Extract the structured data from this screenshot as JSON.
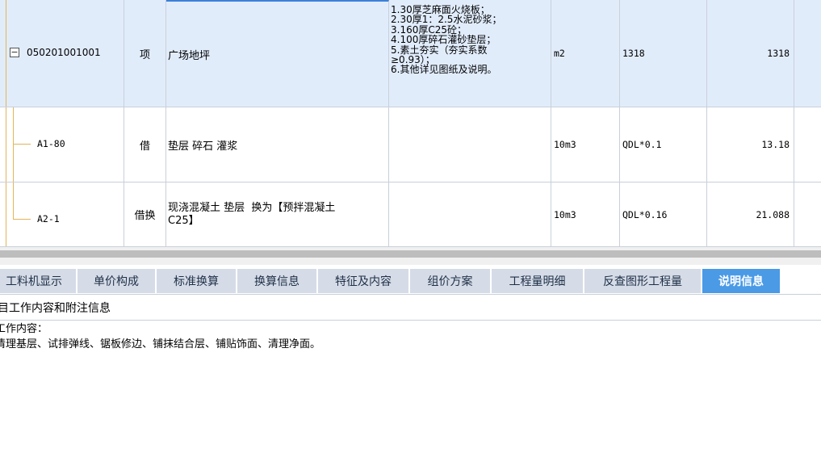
{
  "grid": {
    "rows": [
      {
        "code": "050201001001",
        "type": "项",
        "name": "广场地坪",
        "features": "1.30厚芝麻面火烧板；\n2.30厚1：2.5水泥砂浆；\n3.160厚C25砼；\n4.100厚碎石灌砂垫层；\n5.素土夯实（夯实系数\n≥0.93）；\n6.其他详见图纸及说明。",
        "unit": "m2",
        "expression": "1318",
        "quantity": "1318"
      },
      {
        "code": "A1-80",
        "type": "借",
        "name": "垫层 碎石 灌浆",
        "features": "",
        "unit": "10m3",
        "expression": "QDL*0.1",
        "quantity": "13.18"
      },
      {
        "code": "A2-1",
        "type": "借换",
        "name": "现浇混凝土 垫层  换为【预拌混凝土\nC25】",
        "features": "",
        "unit": "10m3",
        "expression": "QDL*0.16",
        "quantity": "21.088"
      }
    ]
  },
  "tabs": [
    {
      "label": "工料机显示"
    },
    {
      "label": "单价构成"
    },
    {
      "label": "标准换算"
    },
    {
      "label": "换算信息"
    },
    {
      "label": "特征及内容"
    },
    {
      "label": "组价方案"
    },
    {
      "label": "工程量明细"
    },
    {
      "label": "反查图形工程量"
    },
    {
      "label": "说明信息",
      "active": true
    }
  ],
  "description": {
    "header": "目工作内容和附注信息",
    "line1": "工作内容：",
    "line2": "清理基层、试排弹线、锯板修边、铺抹结合层、铺贴饰面、清理净面。"
  },
  "colors": {
    "selected_row": "#e1ecfb",
    "active_tab": "#4a9ae6",
    "tab": "#d5dce7",
    "tree_line": "#e3b45a"
  }
}
